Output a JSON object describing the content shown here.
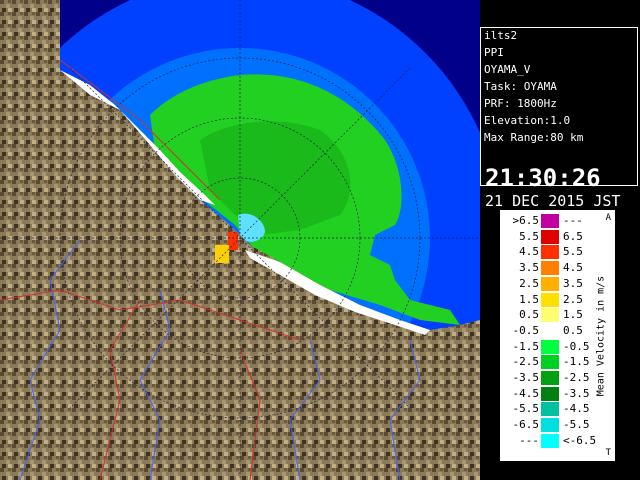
{
  "info": {
    "site": "ilts2",
    "product": "PPI",
    "station": "OYAMA_V",
    "task": "Task: OYAMA",
    "prf": "PRF: 1800Hz",
    "elevation": "Elevation:1.0",
    "max_range": "Max Range:80 km",
    "time": "21:30:26",
    "date": "21 DEC 2015 JST"
  },
  "legend": {
    "title": "Mean Velocity in m/s",
    "corner_top": "A",
    "corner_bottom": "T",
    "rows": [
      {
        "lo": ">6.5",
        "hi": "---",
        "color": "#c000a0"
      },
      {
        "lo": "5.5",
        "hi": "6.5",
        "color": "#e00000"
      },
      {
        "lo": "4.5",
        "hi": "5.5",
        "color": "#ff3000"
      },
      {
        "lo": "3.5",
        "hi": "4.5",
        "color": "#ff8000"
      },
      {
        "lo": "2.5",
        "hi": "3.5",
        "color": "#ffb000"
      },
      {
        "lo": "1.5",
        "hi": "2.5",
        "color": "#ffe000"
      },
      {
        "lo": "0.5",
        "hi": "1.5",
        "color": "#ffff70"
      },
      {
        "lo": "-0.5",
        "hi": "0.5",
        "color": "#ffffff"
      },
      {
        "lo": "-1.5",
        "hi": "-0.5",
        "color": "#00ff40"
      },
      {
        "lo": "-2.5",
        "hi": "-1.5",
        "color": "#00d020"
      },
      {
        "lo": "-3.5",
        "hi": "-2.5",
        "color": "#00a010"
      },
      {
        "lo": "-4.5",
        "hi": "-3.5",
        "color": "#008010"
      },
      {
        "lo": "-5.5",
        "hi": "-4.5",
        "color": "#00c0a0"
      },
      {
        "lo": "-6.5",
        "hi": "-5.5",
        "color": "#00e0e0"
      },
      {
        "lo": "---",
        "hi": "<-6.5",
        "color": "#00ffff"
      }
    ]
  },
  "colors": {
    "sea_far": "#0040ff",
    "sea_near": "#0068ff",
    "land": "#8a7a5a",
    "echo": "#28d828"
  }
}
